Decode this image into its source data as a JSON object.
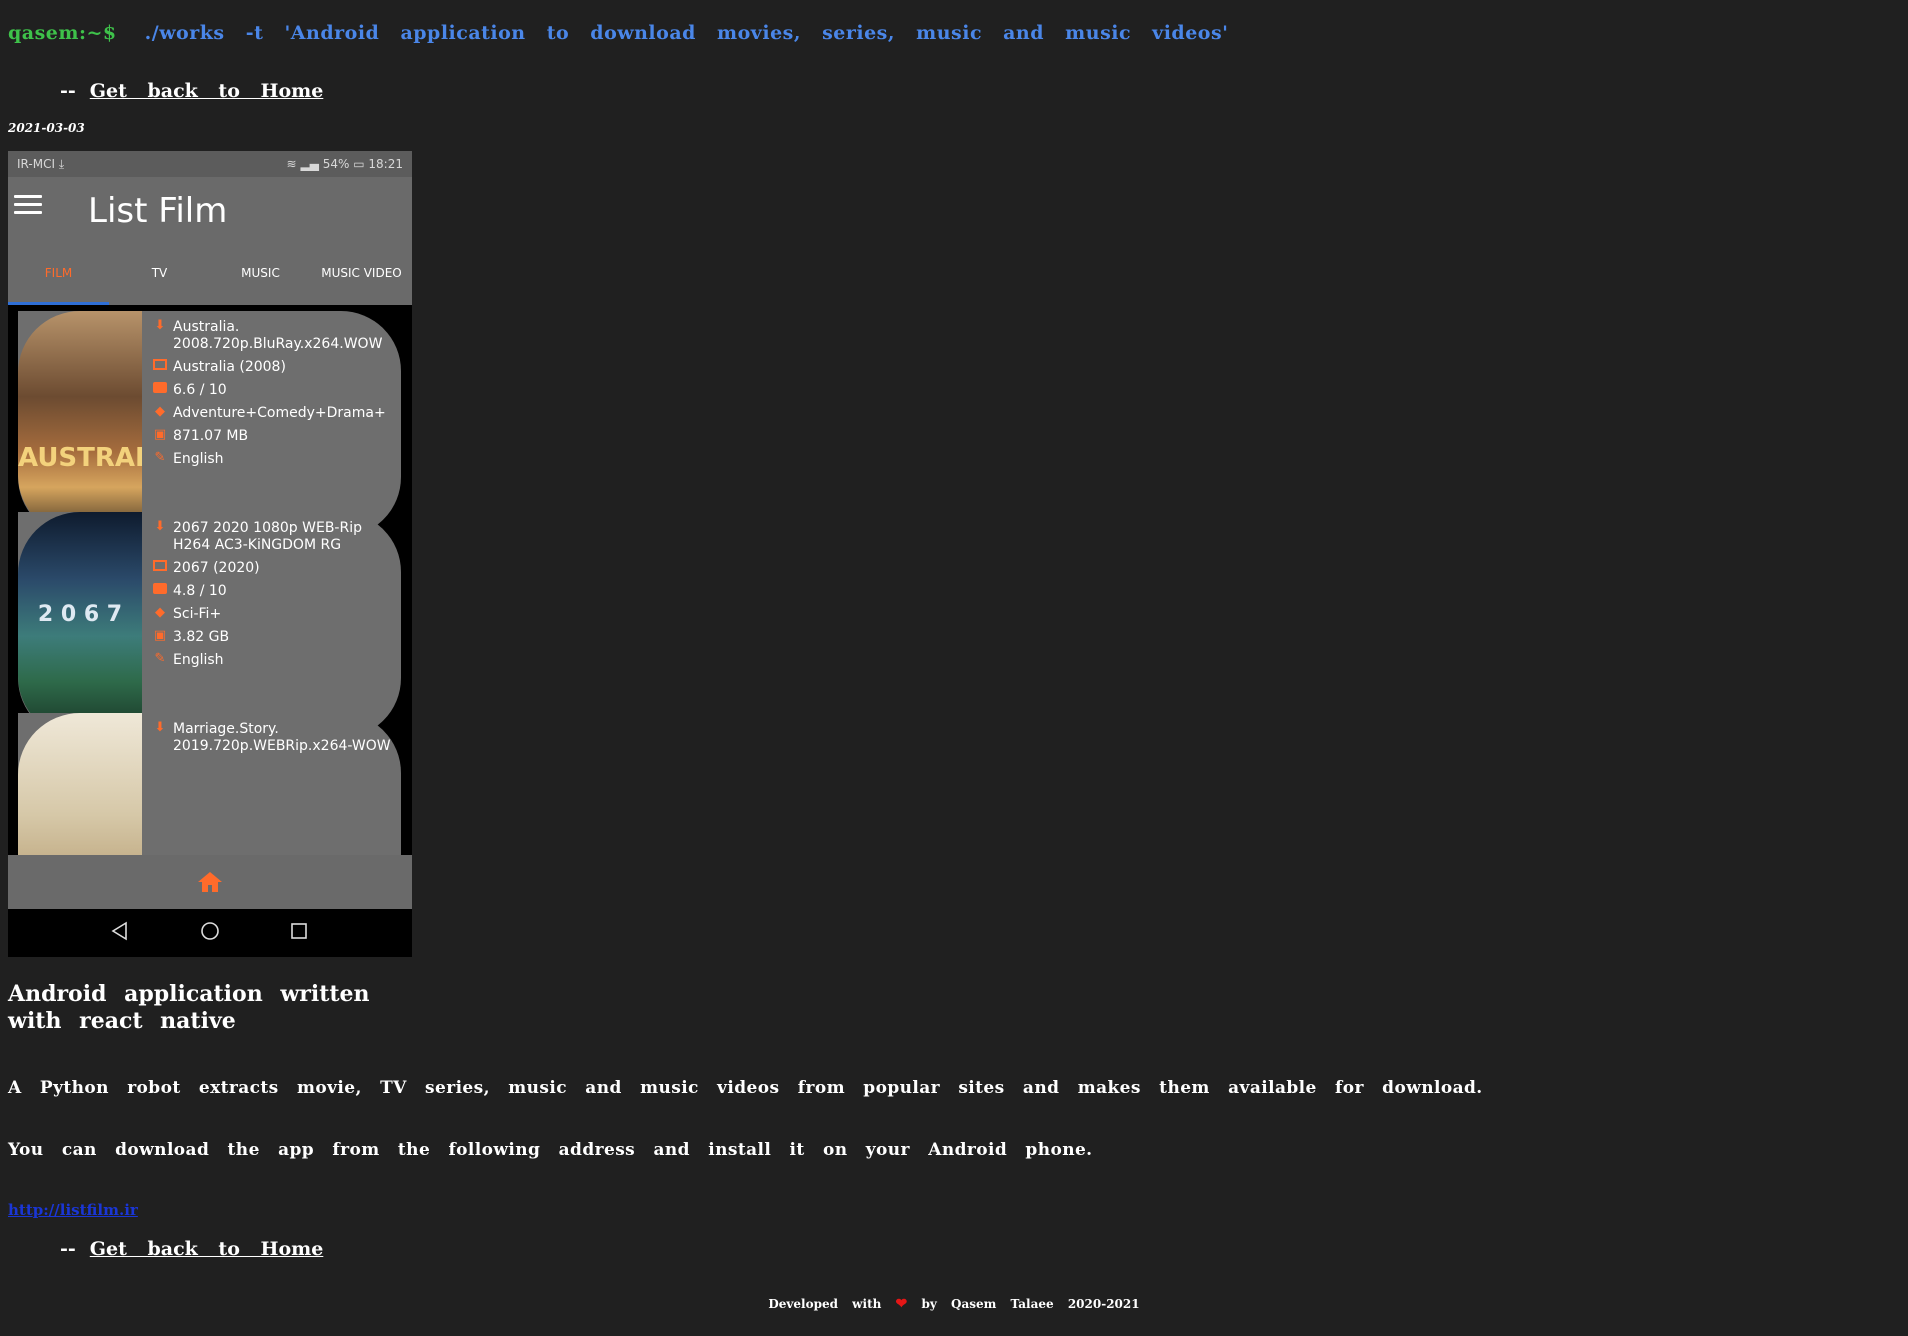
{
  "prompt": {
    "user": "qasem:~$",
    "command": "./works -t 'Android application to download movies, series, music and music videos'"
  },
  "back_link": {
    "dash": "--",
    "label": "Get back to Home"
  },
  "date": "2021-03-03",
  "phone": {
    "status": {
      "carrier": "IR-MCI",
      "battery": "54%",
      "time": "18:21"
    },
    "app_title": "List Film",
    "tabs": [
      {
        "label": "FILM",
        "active": true
      },
      {
        "label": "TV",
        "active": false
      },
      {
        "label": "MUSIC",
        "active": false
      },
      {
        "label": "MUSIC VIDEO",
        "active": false
      }
    ],
    "items": [
      {
        "file": "Australia. 2008.720p.BluRay.x264.WOW",
        "title": "Australia  (2008)",
        "rating": "6.6 / 10",
        "genre": "Adventure+Comedy+Drama+",
        "size": "871.07 MB",
        "language": "English",
        "poster_text": "AUSTRALIA"
      },
      {
        "file": "2067 2020 1080p WEB-Rip H264 AC3-KiNGDOM RG",
        "title": "2067  (2020)",
        "rating": "4.8 / 10",
        "genre": "Sci-Fi+",
        "size": "3.82 GB",
        "language": "English",
        "poster_text": "2 0 6 7"
      },
      {
        "file": "Marriage.Story. 2019.720p.WEBRip.x264-WOW"
      }
    ]
  },
  "heading": "Android application written with react native",
  "paragraphs": [
    "A Python robot extracts movie, TV series, music and music videos from popular sites and makes them available for download.",
    "You can download the app from the following address and install it on your Android phone."
  ],
  "download_link": "http://listfilm.ir",
  "footer": {
    "developed": "Developed with",
    "by": "by Qasem Talaee 2020-2021"
  },
  "colors": {
    "background": "#202020",
    "prompt": "#3ec24a",
    "command": "#4a86e8",
    "accent": "#ff6b2b",
    "heart": "#e51616"
  }
}
